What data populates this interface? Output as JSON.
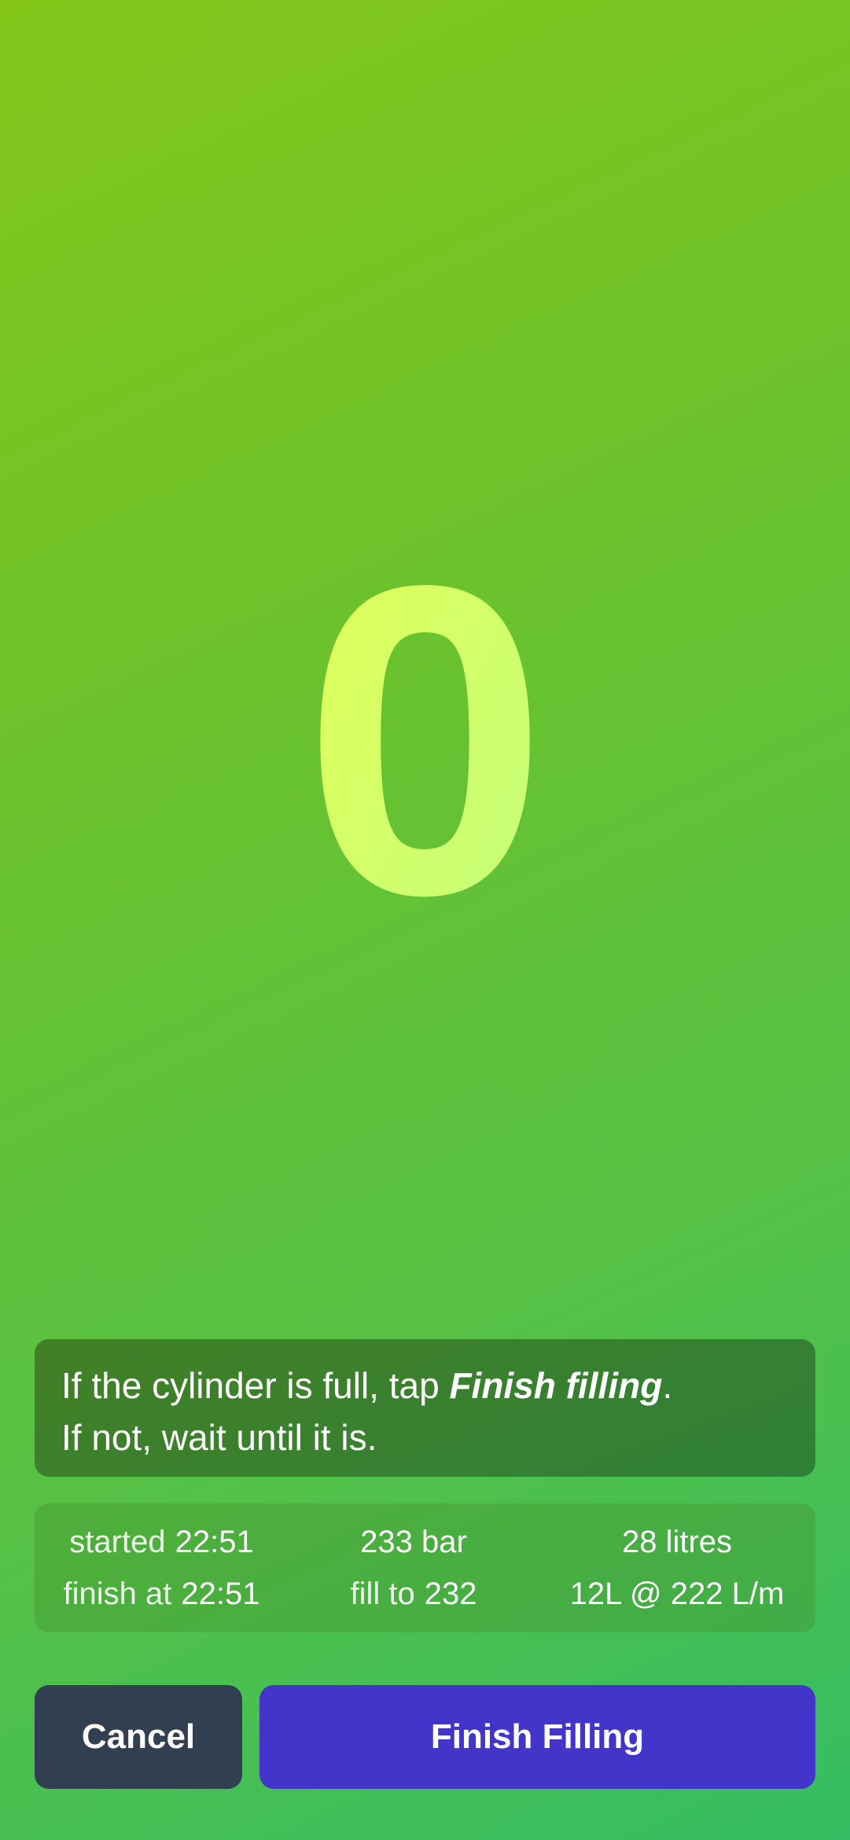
{
  "counter": {
    "value": "0"
  },
  "instruction": {
    "line1_prefix": "If the cylinder is full, tap ",
    "line1_emphasis": "Finish filling",
    "line1_suffix": ".",
    "line2": "If not, wait until it is."
  },
  "stats": {
    "started_label": "started",
    "started_value": "22:51",
    "pressure_value": "233 bar",
    "volume_value": "28 litres",
    "finish_label": "finish at",
    "finish_value": "22:51",
    "fill_to_label": "fill to",
    "fill_to_value": "232",
    "rate_value": "12L @ 222 L/m"
  },
  "buttons": {
    "cancel_label": "Cancel",
    "finish_label": "Finish Filling"
  },
  "colors": {
    "counter_gradient_start": "#e3ff55",
    "counter_gradient_end": "#c2ff7e",
    "cancel_button": "#323f50",
    "finish_button": "#4335c9"
  }
}
